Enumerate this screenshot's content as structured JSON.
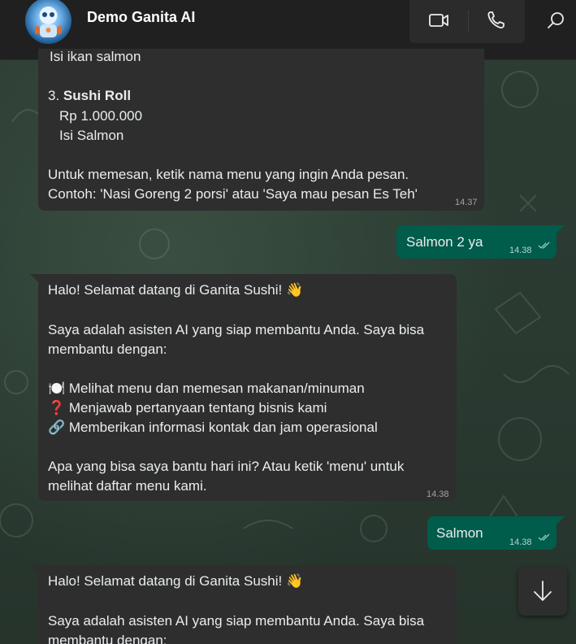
{
  "header": {
    "title": "Demo Ganita AI"
  },
  "messages": {
    "menu_tail": {
      "cut_line": "Isi ikan salmon",
      "item_number": "3.",
      "item_name": "Sushi Roll",
      "item_price": "Rp 1.000.000",
      "item_desc": "Isi Salmon",
      "instruction_1": "Untuk memesan, ketik nama menu yang ingin Anda pesan.",
      "instruction_2": "Contoh: 'Nasi Goreng 2 porsi' atau 'Saya mau pesan Es Teh'",
      "time": "14.37"
    },
    "out_1": {
      "text": "Salmon 2 ya",
      "time": "14.38"
    },
    "greeting_1": {
      "line1": "Halo! Selamat datang di Ganita Sushi! 👋",
      "line2": "Saya adalah asisten AI yang siap membantu Anda. Saya bisa",
      "line3": "membantu dengan:",
      "bullet1": "🍽️ Melihat menu dan memesan makanan/minuman",
      "bullet2": "❓ Menjawab pertanyaan tentang bisnis kami",
      "bullet3": "🔗 Memberikan informasi kontak dan jam operasional",
      "line4": "Apa yang bisa saya bantu hari ini? Atau ketik 'menu' untuk",
      "line5": "melihat daftar menu kami.",
      "time": "14.38"
    },
    "out_2": {
      "text": "Salmon",
      "time": "14.38"
    },
    "greeting_2": {
      "line1": "Halo! Selamat datang di Ganita Sushi! 👋",
      "line2": "Saya adalah asisten AI yang siap membantu Anda. Saya bisa",
      "line3": "membantu dengan:"
    }
  },
  "colors": {
    "incoming_bubble": "#2e2e2e",
    "outgoing_bubble": "#005c4b",
    "header": "#202020"
  }
}
